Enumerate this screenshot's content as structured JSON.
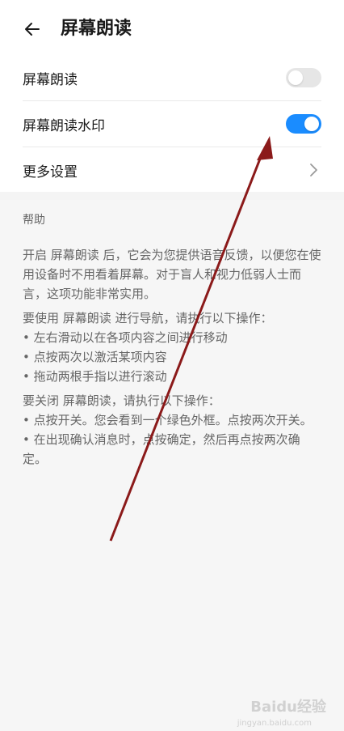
{
  "header": {
    "title": "屏幕朗读"
  },
  "settings": {
    "items": [
      {
        "label": "屏幕朗读",
        "control": "toggle",
        "enabled": false
      },
      {
        "label": "屏幕朗读水印",
        "control": "toggle",
        "enabled": true
      },
      {
        "label": "更多设置",
        "control": "chevron"
      }
    ]
  },
  "help": {
    "title": "帮助",
    "paragraph1": "开启 屏幕朗读 后，它会为您提供语音反馈，以便您在使用设备时不用看着屏幕。对于盲人和视力低弱人士而言，这项功能非常实用。",
    "paragraph2_intro": "要使用 屏幕朗读 进行导航，请执行以下操作：",
    "paragraph2_items": [
      "• 左右滑动以在各项内容之间进行移动",
      "• 点按两次以激活某项内容",
      "• 拖动两根手指以进行滚动"
    ],
    "paragraph3_intro": "要关闭 屏幕朗读，请执行以下操作：",
    "paragraph3_items": [
      "• 点按开关。您会看到一个绿色外框。点按两次开关。",
      "• 在出现确认消息时，点按确定，然后再点按两次确定。"
    ]
  },
  "watermark": {
    "text": "Baidu经验",
    "sub": "jingyan.baidu.com"
  },
  "colors": {
    "toggle_on": "#1a8cff",
    "toggle_off": "#e6e6e6",
    "arrow": "#8b1a1a",
    "help_bg": "#f6f6f6"
  }
}
